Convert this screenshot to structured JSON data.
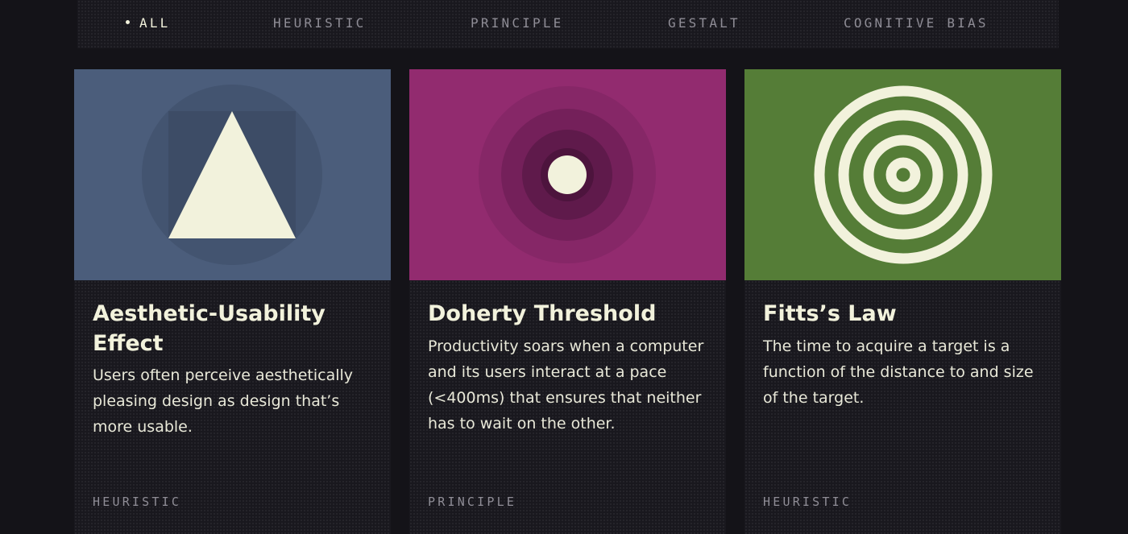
{
  "filters": [
    {
      "label": "ALL",
      "active": true
    },
    {
      "label": "HEURISTIC",
      "active": false
    },
    {
      "label": "PRINCIPLE",
      "active": false
    },
    {
      "label": "GESTALT",
      "active": false
    },
    {
      "label": "COGNITIVE BIAS",
      "active": false
    }
  ],
  "cards": [
    {
      "title": "Aesthetic-Usability Effect",
      "description": "Users often perceive aesthetically pleasing design as design that’s more usable.",
      "category": "HEURISTIC",
      "illustration": "triangle-icon",
      "bg_color": "#4b5d7b"
    },
    {
      "title": "Doherty Threshold",
      "description": "Productivity soars when a computer and its users interact at a pace (<400ms) that ensures that neither has to wait on the other.",
      "category": "PRINCIPLE",
      "illustration": "concentric-fade-icon",
      "bg_color": "#922b6f"
    },
    {
      "title": "Fitts’s Law",
      "description": "The time to acquire a target is a function of the distance to and size of the target.",
      "category": "HEURISTIC",
      "illustration": "target-rings-icon",
      "bg_color": "#557d37"
    }
  ],
  "colors": {
    "page_bg": "#141318",
    "text_primary": "#f2f2dc",
    "text_muted": "#8f8d96",
    "shape_fill": "#f2f2dc"
  }
}
